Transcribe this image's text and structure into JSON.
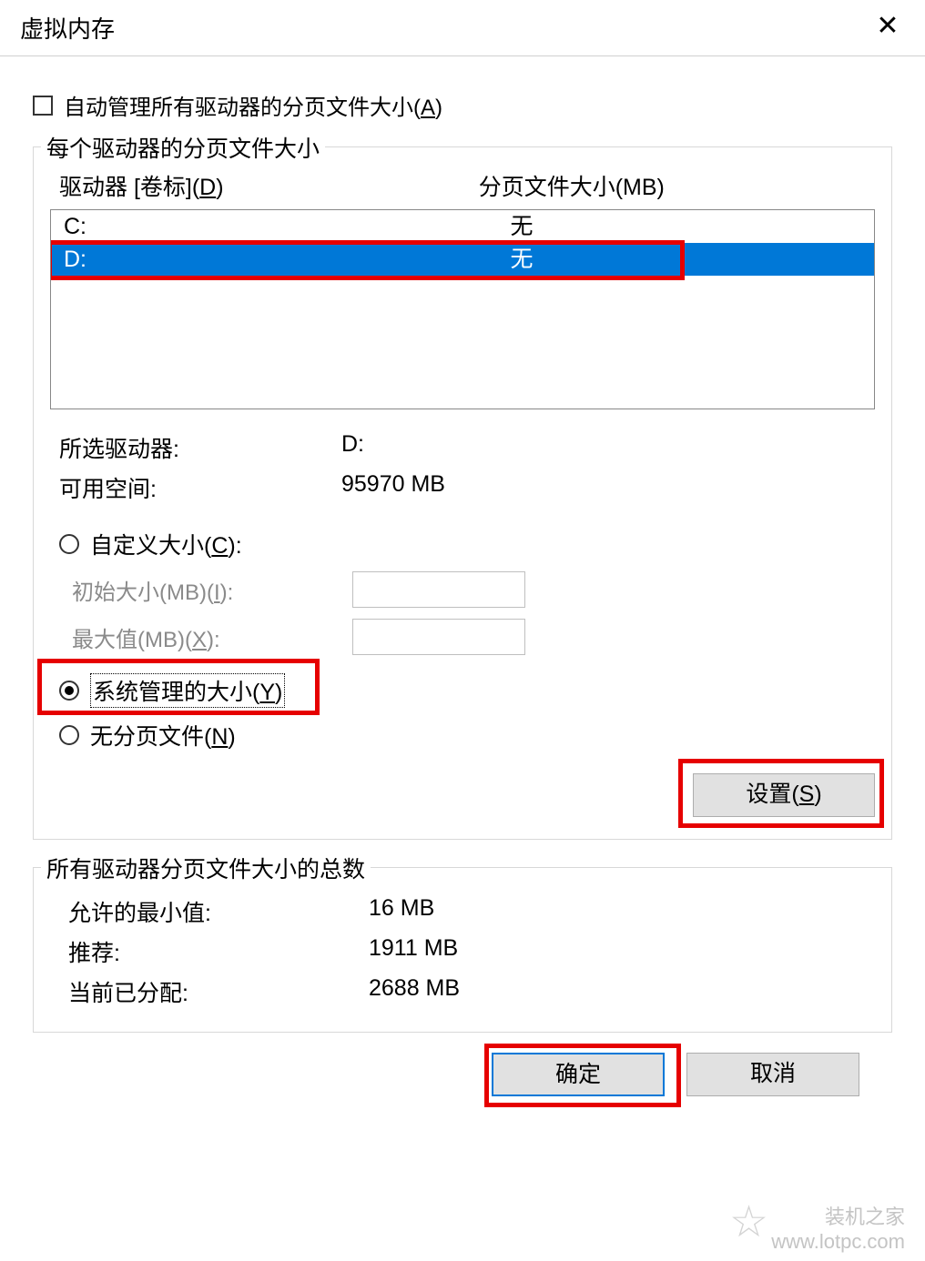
{
  "window": {
    "title": "虚拟内存"
  },
  "auto_manage": {
    "label_pre": "自动管理所有驱动器的分页文件大小(",
    "accel": "A",
    "label_post": ")"
  },
  "per_drive": {
    "legend": "每个驱动器的分页文件大小",
    "col_drive_pre": "驱动器 [卷标](",
    "col_drive_accel": "D",
    "col_drive_post": ")",
    "col_size": "分页文件大小(MB)",
    "rows": [
      {
        "drive": "C:",
        "size": "无",
        "selected": false
      },
      {
        "drive": "D:",
        "size": "无",
        "selected": true
      }
    ],
    "selected_drive_lbl": "所选驱动器:",
    "selected_drive_val": "D:",
    "free_space_lbl": "可用空间:",
    "free_space_val": "95970 MB",
    "custom_pre": "自定义大小(",
    "custom_accel": "C",
    "custom_post": "):",
    "initial_pre": "初始大小(MB)(",
    "initial_accel": "I",
    "initial_post": "):",
    "max_pre": "最大值(MB)(",
    "max_accel": "X",
    "max_post": "):",
    "system_pre": "系统管理的大小(",
    "system_accel": "Y",
    "system_post": ")",
    "none_pre": "无分页文件(",
    "none_accel": "N",
    "none_post": ")",
    "set_btn_pre": "设置(",
    "set_btn_accel": "S",
    "set_btn_post": ")"
  },
  "totals": {
    "legend": "所有驱动器分页文件大小的总数",
    "min_lbl": "允许的最小值:",
    "min_val": "16 MB",
    "rec_lbl": "推荐:",
    "rec_val": "1911 MB",
    "cur_lbl": "当前已分配:",
    "cur_val": "2688 MB"
  },
  "buttons": {
    "ok": "确定",
    "cancel": "取消"
  },
  "watermark": {
    "line1": "装机之家",
    "line2": "www.lotpc.com"
  }
}
